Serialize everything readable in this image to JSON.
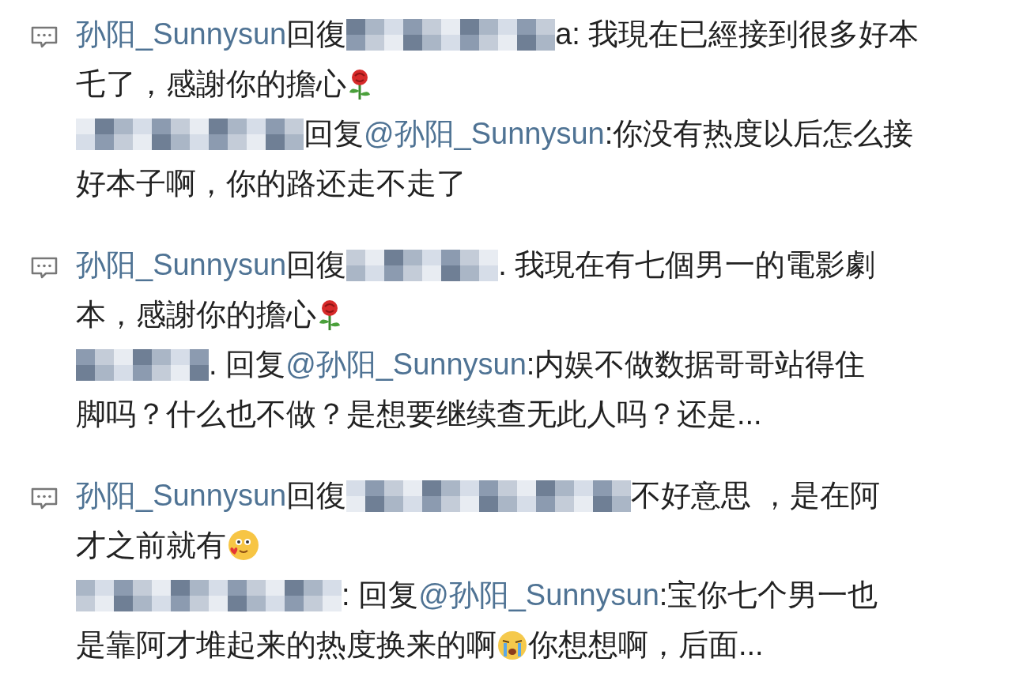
{
  "comments": [
    {
      "main": [
        [
          {
            "kind": "author",
            "text": "孙阳_Sunnysun"
          },
          {
            "kind": "text",
            "text": " 回復"
          },
          {
            "kind": "mosaic"
          },
          {
            "kind": "text",
            "text": "a: 我現在已經接到很多好本"
          }
        ],
        [
          {
            "kind": "text",
            "text": "乇了，感謝你的擔心"
          },
          {
            "kind": "rose"
          }
        ]
      ],
      "reply": [
        [
          {
            "kind": "mosaic"
          },
          {
            "kind": "text",
            "text": "回复 "
          },
          {
            "kind": "mention",
            "text": "@孙阳_Sunnysun"
          },
          {
            "kind": "text",
            "text": ":你没有热度以后怎么接"
          }
        ],
        [
          {
            "kind": "text",
            "text": "好本子啊，你的路还走不走了"
          }
        ]
      ]
    },
    {
      "main": [
        [
          {
            "kind": "author",
            "text": "孙阳_Sunnysun"
          },
          {
            "kind": "text",
            "text": " 回復"
          },
          {
            "kind": "mosaic"
          },
          {
            "kind": "text",
            "text": ". 我現在有七個男一的電影劇"
          }
        ],
        [
          {
            "kind": "text",
            "text": "本，感謝你的擔心"
          },
          {
            "kind": "rose"
          }
        ]
      ],
      "reply": [
        [
          {
            "kind": "mosaic"
          },
          {
            "kind": "text",
            "text": ". 回复 "
          },
          {
            "kind": "mention",
            "text": "@孙阳_Sunnysun"
          },
          {
            "kind": "text",
            "text": ":内娱不做数据哥哥站得住"
          }
        ],
        [
          {
            "kind": "text",
            "text": "脚吗？什么也不做？是想要继续查无此人吗？还是..."
          }
        ]
      ]
    },
    {
      "main": [
        [
          {
            "kind": "author",
            "text": "孙阳_Sunnysun"
          },
          {
            "kind": "text",
            "text": " 回復"
          },
          {
            "kind": "mosaic"
          },
          {
            "kind": "text",
            "text": "不好意思 ，是在阿"
          }
        ],
        [
          {
            "kind": "text",
            "text": "才之前就有"
          },
          {
            "kind": "smile"
          }
        ]
      ],
      "reply": [
        [
          {
            "kind": "mosaic"
          },
          {
            "kind": "text",
            "text": ": 回复 "
          },
          {
            "kind": "mention",
            "text": "@孙阳_Sunnysun"
          },
          {
            "kind": "text",
            "text": ":宝你七个男一也"
          }
        ],
        [
          {
            "kind": "text",
            "text": "是靠阿才堆起来的热度换来的啊"
          },
          {
            "kind": "cry"
          },
          {
            "kind": "text",
            "text": "你想想啊，后面..."
          }
        ]
      ]
    }
  ]
}
